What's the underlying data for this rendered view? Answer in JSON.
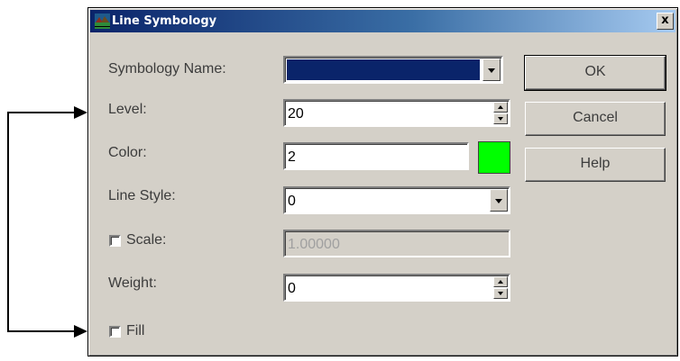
{
  "dialog": {
    "title": "Line Symbology",
    "close_glyph": "x",
    "icon": "application-icon"
  },
  "fields": {
    "symbology_name": {
      "label": "Symbology Name:",
      "value": "",
      "selected_color": "#0a246a"
    },
    "level": {
      "label": "Level:",
      "value": "20"
    },
    "color": {
      "label": "Color:",
      "value": "2",
      "swatch_color": "#00ff00"
    },
    "line_style": {
      "label": "Line Style:",
      "value": "0"
    },
    "scale": {
      "label": "Scale:",
      "value": "1.00000",
      "checked": false,
      "enabled": false
    },
    "weight": {
      "label": "Weight:",
      "value": "0"
    },
    "fill": {
      "label": "Fill",
      "checked": false
    }
  },
  "buttons": {
    "ok": "OK",
    "cancel": "Cancel",
    "help": "Help"
  },
  "colors": {
    "dialog_bg": "#d4d0c8",
    "title_gradient_start": "#0a246a",
    "title_gradient_end": "#a6caf0",
    "swatch": "#00ff00"
  }
}
